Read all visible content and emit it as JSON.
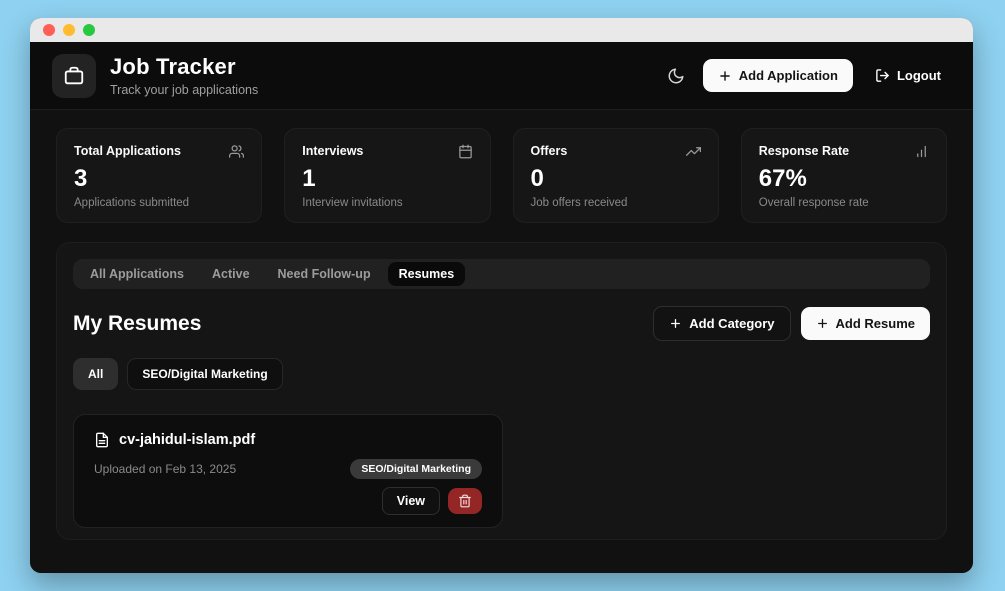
{
  "header": {
    "title": "Job Tracker",
    "subtitle": "Track your job applications",
    "add_application_label": "Add Application",
    "logout_label": "Logout"
  },
  "stats": [
    {
      "label": "Total Applications",
      "value": "3",
      "description": "Applications submitted",
      "icon": "users-icon"
    },
    {
      "label": "Interviews",
      "value": "1",
      "description": "Interview invitations",
      "icon": "calendar-icon"
    },
    {
      "label": "Offers",
      "value": "0",
      "description": "Job offers received",
      "icon": "trending-up-icon"
    },
    {
      "label": "Response Rate",
      "value": "67%",
      "description": "Overall response rate",
      "icon": "bar-chart-icon"
    }
  ],
  "tabs": [
    {
      "label": "All Applications",
      "active": false
    },
    {
      "label": "Active",
      "active": false
    },
    {
      "label": "Need Follow-up",
      "active": false
    },
    {
      "label": "Resumes",
      "active": true
    }
  ],
  "resumes_section": {
    "title": "My Resumes",
    "add_category_label": "Add Category",
    "add_resume_label": "Add Resume",
    "filters": [
      {
        "label": "All",
        "active": true
      },
      {
        "label": "SEO/Digital Marketing",
        "active": false
      }
    ],
    "items": [
      {
        "filename": "cv-jahidul-islam.pdf",
        "uploaded": "Uploaded on Feb 13, 2025",
        "category": "SEO/Digital Marketing",
        "view_label": "View"
      }
    ]
  },
  "colors": {
    "desktop_background": "#8ed1f0",
    "window_background": "#111111",
    "card_background": "#161616",
    "accent_white": "#fafafa",
    "danger_red": "#942626",
    "traffic_red": "#ff5f57",
    "traffic_yellow": "#febc2e",
    "traffic_green": "#28c840"
  }
}
